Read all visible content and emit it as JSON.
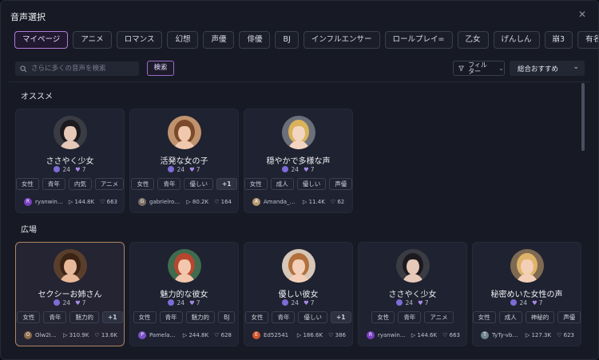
{
  "title": "音声選択",
  "tabs": [
    "マイページ",
    "アニメ",
    "ロマンス",
    "幻想",
    "声優",
    "俳優",
    "BJ",
    "インフルエンサー",
    "ロールプレイ=",
    "乙女",
    "げんしん",
    "崩3",
    "有名人"
  ],
  "active_tab": 0,
  "search": {
    "placeholder": "さらに多くの音声を検索",
    "button": "検索"
  },
  "filter_label": "フィルター",
  "sort_value": "総合おすすめ",
  "sections": [
    {
      "label": "オススメ",
      "cards": [
        {
          "name": "ささやく少女",
          "a": "24",
          "b": "7",
          "tags": [
            "女性",
            "青年",
            "内気",
            "アニメ"
          ],
          "user": "ryanwinso...",
          "user_initial": "R",
          "plays": "144.8K",
          "likes": "663",
          "av_color": "#7a3fc2"
        },
        {
          "name": "活発な女の子",
          "a": "24",
          "b": "7",
          "tags": [
            "女性",
            "青年",
            "優しい",
            "+1"
          ],
          "user": "gabrielrodri...",
          "user_initial": "G",
          "plays": "80.2K",
          "likes": "164",
          "av_color": "#7a6f62"
        },
        {
          "name": "穏やかで多様な声",
          "a": "24",
          "b": "7",
          "tags": [
            "女性",
            "成人",
            "優しい",
            "声優"
          ],
          "user": "Amanda_Fre...",
          "user_initial": "A",
          "plays": "11.4K",
          "likes": "62",
          "av_color": "#b89a70"
        }
      ]
    },
    {
      "label": "広場",
      "cards": [
        {
          "name": "セクシーお姉さん",
          "a": "24",
          "b": "7",
          "tags": [
            "女性",
            "青年",
            "魅力的",
            "+1"
          ],
          "user": "Olw2IF...",
          "user_initial": "O",
          "plays": "310.9K",
          "likes": "13.6K",
          "av_color": "#8c6b4a"
        },
        {
          "name": "魅力的な彼女",
          "a": "24",
          "b": "7",
          "tags": [
            "女性",
            "青年",
            "魅力的",
            "BJ"
          ],
          "user": "PamelaA...",
          "user_initial": "P",
          "plays": "244.8K",
          "likes": "628",
          "av_color": "#7a52c8"
        },
        {
          "name": "優しい彼女",
          "a": "24",
          "b": "7",
          "tags": [
            "女性",
            "青年",
            "優しい",
            "+1"
          ],
          "user": "Ed52541",
          "user_initial": "E",
          "plays": "186.6K",
          "likes": "386",
          "av_color": "#d0552e"
        },
        {
          "name": "ささやく少女",
          "a": "24",
          "b": "7",
          "tags": [
            "女性",
            "青年",
            "アニメ"
          ],
          "user": "ryanwinso...",
          "user_initial": "R",
          "plays": "144.6K",
          "likes": "663",
          "av_color": "#7a3fc2"
        },
        {
          "name": "秘密めいた女性の声",
          "a": "24",
          "b": "7",
          "tags": [
            "女性",
            "成人",
            "神秘的",
            "声優"
          ],
          "user": "TyTy-vb5pr",
          "user_initial": "T",
          "plays": "127.3K",
          "likes": "623",
          "av_color": "#6f8590"
        }
      ]
    }
  ],
  "colors": {
    "accent": "#b07ad8",
    "selected_border": "#b08462",
    "background": "#171a24",
    "card": "#1f2230"
  }
}
